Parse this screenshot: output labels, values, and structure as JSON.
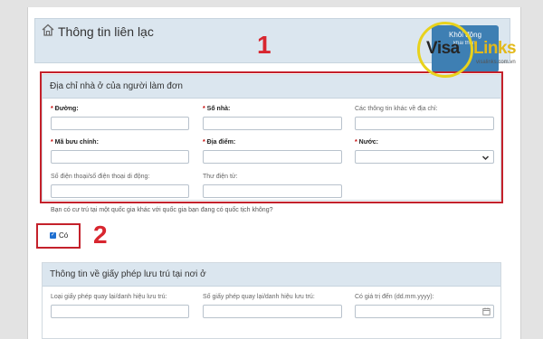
{
  "contact": {
    "title": "Thông tin liên lạc",
    "action_button": {
      "label": "Khôi động",
      "sub": "khai thêm"
    },
    "address_section": {
      "title": "Địa chỉ nhà ở của người làm đơn",
      "fields": {
        "street": {
          "label": "Đường:",
          "required": true,
          "value": ""
        },
        "house_no": {
          "label": "Số nhà:",
          "required": true,
          "value": ""
        },
        "other_info": {
          "label": "Các thông tin khác về địa chỉ:",
          "required": false,
          "value": ""
        },
        "postal": {
          "label": "Mã bưu chính:",
          "required": true,
          "value": ""
        },
        "place": {
          "label": "Địa điểm:",
          "required": true,
          "value": ""
        },
        "country": {
          "label": "Nước:",
          "required": true,
          "value": ""
        },
        "phone": {
          "label": "Số điện thoại/số điện thoại di động:",
          "required": false,
          "value": ""
        },
        "email": {
          "label": "Thư điện tử:",
          "required": false,
          "value": ""
        }
      }
    },
    "question": "Bạn có cư trú tại một quốc gia khác với quốc gia bạn đang có quốc tịch không?",
    "checkbox": {
      "label": "Có",
      "checked": true
    },
    "permit_section": {
      "title": "Thông tin về giấy phép lưu trú tại nơi ở",
      "fields": {
        "type": {
          "label": "Loại giấy phép quay lại/danh hiệu lưu trú:",
          "value": ""
        },
        "number": {
          "label": "Số giấy phép quay lại/danh hiệu lưu trú:",
          "value": ""
        },
        "valid_until": {
          "label": "Có giá trị đến (dd.mm.yyyy):",
          "value": ""
        }
      }
    }
  },
  "annotations": {
    "box1_number": "1",
    "box2_number": "2",
    "color": "#d8262f"
  },
  "watermark": {
    "visa": "Visa",
    "links": "Links",
    "url": "visalinks.com.vn"
  },
  "icons": {
    "home": "home-icon",
    "dropdown": "chevron-down-icon",
    "calendar": "calendar-icon",
    "check": "check-icon"
  }
}
